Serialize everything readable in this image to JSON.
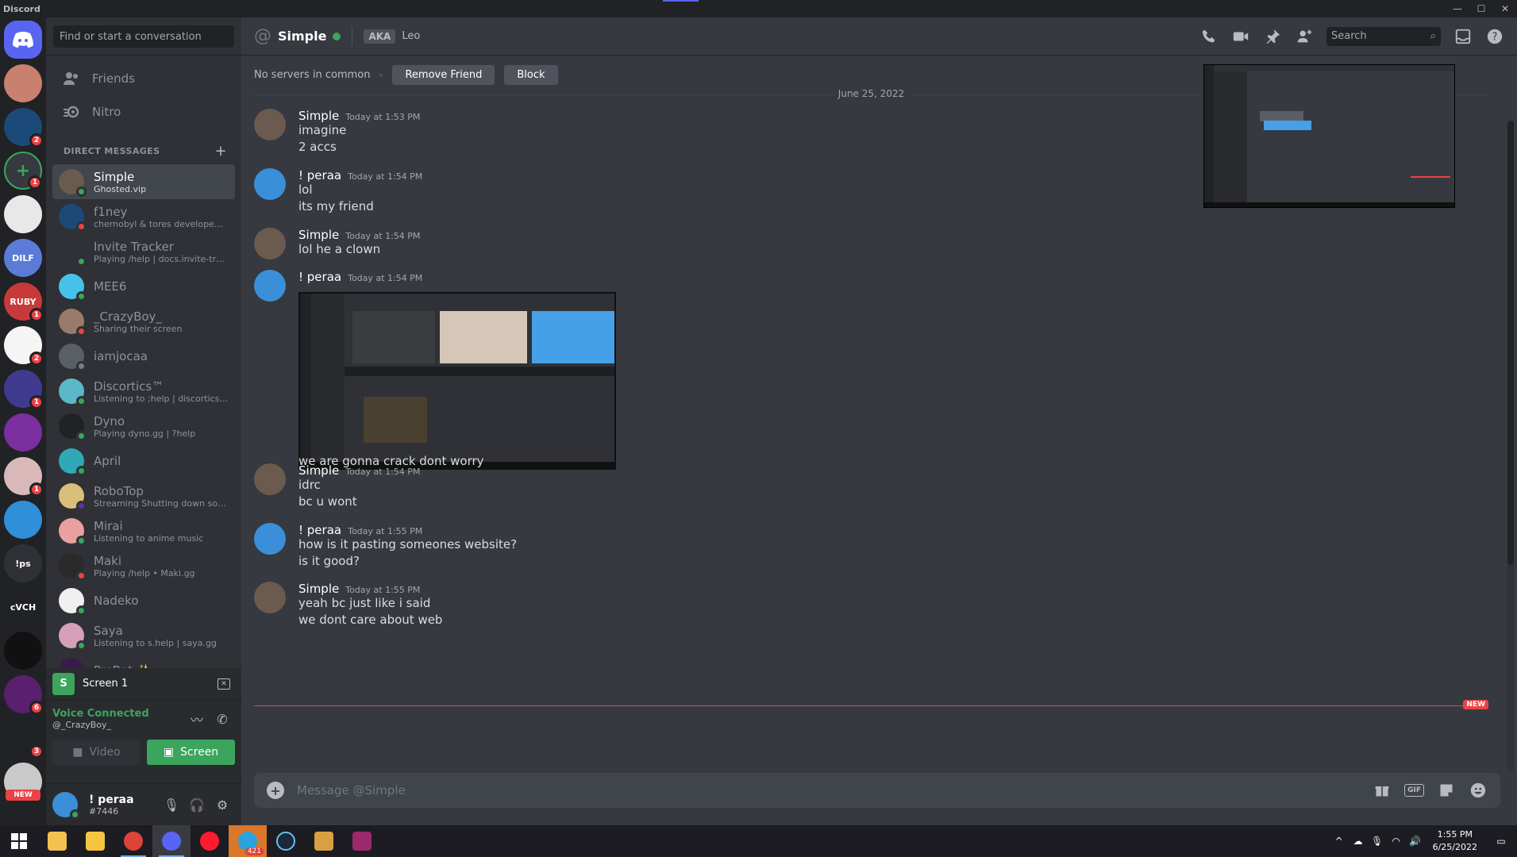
{
  "app": {
    "title": "Discord",
    "window_controls": [
      "—",
      "☐",
      "✕"
    ]
  },
  "guilds": [
    {
      "name": "home",
      "color": "#5865f2"
    },
    {
      "color": "#c9806e",
      "badge": ""
    },
    {
      "color": "#1c4a78",
      "badge": "2"
    },
    {
      "color": "#36393f",
      "badge": "1",
      "icon": "plus"
    },
    {
      "color": "#e8e8e8"
    },
    {
      "color": "#5a7bd6",
      "label": "DILF"
    },
    {
      "color": "#c83a3a",
      "badge": "1",
      "label": "RUBY"
    },
    {
      "color": "#f5f5f5",
      "badge": "2"
    },
    {
      "color": "#3f3a8e",
      "badge": "1"
    },
    {
      "color": "#7a2fa0"
    },
    {
      "color": "#d8b8b8",
      "badge": "1"
    },
    {
      "color": "#2f8fd8"
    },
    {
      "color": "#2f3136",
      "label": "!ps"
    },
    {
      "color": "#202225",
      "label": "cVCH"
    },
    {
      "color": "#111111"
    },
    {
      "color": "#5a1f6e",
      "badge": "6"
    },
    {
      "color": "#202225",
      "badge": "3"
    },
    {
      "color": "#c9c9c9",
      "new": "NEW"
    }
  ],
  "sidebar": {
    "search_placeholder": "Find or start a conversation",
    "nav": [
      {
        "label": "Friends"
      },
      {
        "label": "Nitro"
      }
    ],
    "dm_header": "DIRECT MESSAGES",
    "dms": [
      {
        "name": "Simple",
        "sub": "Ghosted.vip",
        "status": "on",
        "color": "#6b5a4e",
        "active": true
      },
      {
        "name": "f1ney",
        "sub": "chernobyl & tores develope...",
        "status": "dnd",
        "color": "#1c4a78"
      },
      {
        "name": "Invite Tracker",
        "sub": "Playing /help | docs.invite-trac...",
        "status": "on",
        "color": "#2f3136"
      },
      {
        "name": "MEE6",
        "sub": "",
        "status": "on",
        "color": "#46c2e8"
      },
      {
        "name": "_CrazyBoy_",
        "sub": "Sharing their screen",
        "status": "dnd",
        "color": "#9a7a6a"
      },
      {
        "name": "iamjocaa",
        "sub": "",
        "status": "off",
        "color": "#5a5f66"
      },
      {
        "name": "Discortics™",
        "sub": "Listening to ;help | discortics.c...",
        "status": "on",
        "color": "#5ab8c8"
      },
      {
        "name": "Dyno",
        "sub": "Playing dyno.gg | ?help",
        "status": "on",
        "color": "#202225"
      },
      {
        "name": "April",
        "sub": "",
        "status": "on",
        "color": "#2fa8b8"
      },
      {
        "name": "RoboTop",
        "sub": "Streaming Shutting down soon ...",
        "status": "str",
        "color": "#d8c07a"
      },
      {
        "name": "Mirai",
        "sub": "Listening to anime music",
        "status": "on",
        "color": "#e8a0a0"
      },
      {
        "name": "Maki",
        "sub": "Playing /help • Maki.gg",
        "status": "dnd",
        "color": "#2a2a2a"
      },
      {
        "name": "Nadeko",
        "sub": "",
        "status": "on",
        "color": "#f0f0f0"
      },
      {
        "name": "Saya",
        "sub": "Listening to s.help | saya.gg",
        "status": "on",
        "color": "#d8a0b8"
      },
      {
        "name": "ProBot ✨",
        "sub": "",
        "status": "on",
        "color": "#3a1a4a"
      }
    ]
  },
  "voice": {
    "screen_label": "Screen 1",
    "connected": "Voice Connected",
    "channel": "@_CrazyBoy_",
    "video_label": "Video",
    "screen_btn": "Screen"
  },
  "user": {
    "name": "! peraa",
    "tag": "#7446"
  },
  "header": {
    "title": "Simple",
    "aka": "AKA",
    "aka_name": "Leo",
    "search": "Search"
  },
  "infobar": {
    "text": "No servers in common",
    "remove": "Remove Friend",
    "block": "Block"
  },
  "date_divider": "June 25, 2022",
  "messages": [
    {
      "author": "Simple",
      "time": "Today at 1:53 PM",
      "lines": [
        "imagine",
        "2 accs"
      ],
      "av": "#6b5a4e"
    },
    {
      "author": "! peraa",
      "time": "Today at 1:54 PM",
      "lines": [
        "lol",
        "its my friend"
      ],
      "av": "#3a8fd8"
    },
    {
      "author": "Simple",
      "time": "Today at 1:54 PM",
      "lines": [
        "lol he a clown"
      ],
      "av": "#6b5a4e"
    },
    {
      "author": "! peraa",
      "time": "Today at 1:54 PM",
      "lines": [
        "we are gonna crack dont worry"
      ],
      "av": "#3a8fd8",
      "attachment": true
    },
    {
      "author": "Simple",
      "time": "Today at 1:54 PM",
      "lines": [
        "idrc",
        "bc u wont"
      ],
      "av": "#6b5a4e"
    },
    {
      "author": "! peraa",
      "time": "Today at 1:55 PM",
      "lines": [
        "how is it pasting someones website?",
        "is it good?"
      ],
      "av": "#3a8fd8"
    },
    {
      "author": "Simple",
      "time": "Today at 1:55 PM",
      "lines": [
        "yeah bc just like i said",
        "we dont care about web"
      ],
      "av": "#6b5a4e"
    }
  ],
  "new_label": "NEW",
  "composer": {
    "placeholder": "Message @Simple",
    "gif": "GIF"
  },
  "taskbar": {
    "telegram_badge": "421",
    "time": "1:55 PM",
    "date": "6/25/2022"
  }
}
